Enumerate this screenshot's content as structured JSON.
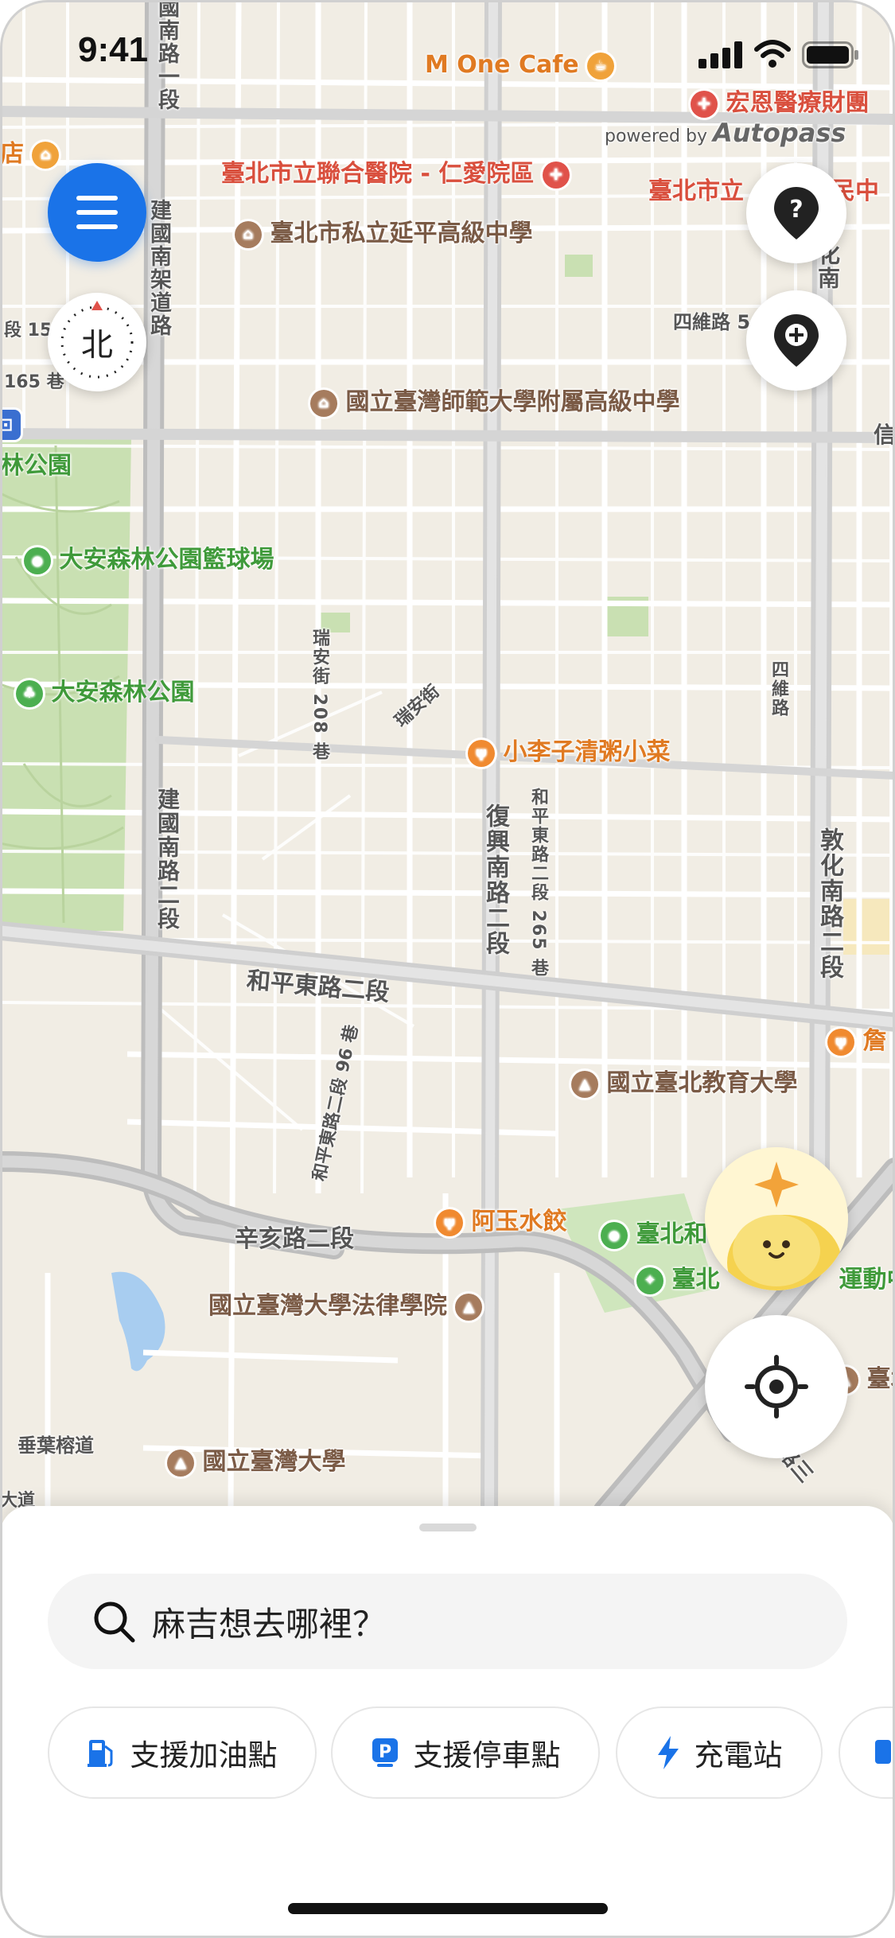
{
  "status_bar": {
    "time": "9:41"
  },
  "map": {
    "attribution_prefix": "powered by",
    "attribution_brand": "Autopass",
    "compass_label": "北",
    "pois": {
      "m_one_cafe": "M One Cafe",
      "hongen_hospital": "宏恩醫療財團",
      "renai_hospital": "臺北市立聯合醫院 - 仁愛院區",
      "yanping_school": "臺北市私立延平高級中學",
      "taipei_city_partial": "臺北市立",
      "people_suffix": "民中",
      "ntnu_affiliated": "國立臺灣師範大學附屬高級中學",
      "forest_park_court": "大安森林公園籃球場",
      "forest_park": "大安森林公園",
      "forest_park_partial": "林公園",
      "xiaolizi": "小李子清粥小菜",
      "ntue": "國立臺北教育大學",
      "ayu_dumplings": "阿玉水餃",
      "taipei_partial1": "臺北和",
      "taipei_partial2": "臺北",
      "sports_partial": "運動中",
      "ntu_law": "國立臺灣大學法律學院",
      "ntu": "國立臺灣大學",
      "hotel_partial": "店",
      "zhan_partial": "詹",
      "tai_partial": "臺北"
    },
    "roads": {
      "jianguo_s_sec1": "國南路一段",
      "jianguo_elevated": "建國南架道路",
      "duan15": "段 15",
      "lane165": "165 巷",
      "siwei_lane5": "四維路 5",
      "ruian_lane208": "瑞安街 208 巷",
      "ruian_st": "瑞安街",
      "siwei_rd": "四維路",
      "jianguo_s_sec2": "建國南路二段",
      "fuxing_s_sec2": "復興南路二段",
      "heping_e_lane265": "和平東路二段 265 巷",
      "dunhua_s_sec2": "敦化南路二段",
      "heping_e_sec2": "和平東路二段",
      "heping_e_lane96": "和平東路二段 96 巷",
      "xinhai_sec2": "辛亥路二段",
      "chuiye_st": "垂葉榕道",
      "da_road": "大道",
      "xin_partial": "信",
      "dunhua_partial": "化南",
      "lu_san": "路三"
    }
  },
  "sheet": {
    "search_placeholder": "麻吉想去哪裡？",
    "chips": [
      {
        "label": "支援加油點",
        "icon": "gas-station-icon"
      },
      {
        "label": "支援停車點",
        "icon": "parking-icon"
      },
      {
        "label": "充電站",
        "icon": "lightning-icon"
      }
    ]
  },
  "colors": {
    "accent": "#1a73e8",
    "map_bg": "#f1ede4",
    "park": "#c8dfb0",
    "road_major": "#c9c9c9",
    "poi_red": "#d94f3d",
    "poi_brown": "#7a5a45",
    "poi_green": "#3f9a3a",
    "poi_orange": "#e07a22"
  }
}
